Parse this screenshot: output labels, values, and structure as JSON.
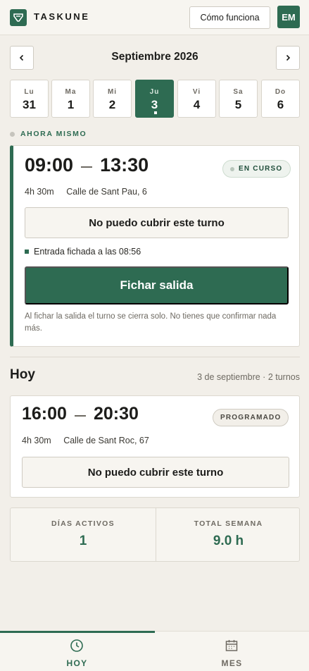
{
  "header": {
    "brand": "TASKUNE",
    "how_it_works": "Cómo funciona",
    "avatar_initials": "EM"
  },
  "calendar": {
    "month_title": "Septiembre 2026",
    "days": [
      {
        "name": "Lu",
        "date": "31",
        "active": false
      },
      {
        "name": "Ma",
        "date": "1",
        "active": false
      },
      {
        "name": "Mi",
        "date": "2",
        "active": false
      },
      {
        "name": "Ju",
        "date": "3",
        "active": true
      },
      {
        "name": "Vi",
        "date": "4",
        "active": false
      },
      {
        "name": "Sa",
        "date": "5",
        "active": false
      },
      {
        "name": "Do",
        "date": "6",
        "active": false
      }
    ]
  },
  "now": {
    "label": "AHORA MISMO",
    "shift": {
      "start": "09:00",
      "end": "13:30",
      "status": "EN CURSO",
      "duration": "4h 30m",
      "location": "Calle de Sant Pau, 6",
      "cant_cover": "No puedo cubrir este turno",
      "checkin": "Entrada fichada a las 08:56",
      "checkout_button": "Fichar salida",
      "note": "Al fichar la salida el turno se cierra solo. No tienes que confirmar nada más."
    }
  },
  "today": {
    "title": "Hoy",
    "meta": "3 de septiembre · 2 turnos",
    "shift": {
      "start": "16:00",
      "end": "20:30",
      "status": "PROGRAMADO",
      "duration": "4h 30m",
      "location": "Calle de Sant Roc, 67",
      "cant_cover": "No puedo cubrir este turno"
    }
  },
  "stats": {
    "active_days_label": "DÍAS ACTIVOS",
    "active_days_value": "1",
    "week_total_label": "TOTAL SEMANA",
    "week_total_value": "9.0 h"
  },
  "tabs": {
    "today": "HOY",
    "month": "MES"
  },
  "colors": {
    "accent": "#2e6b52",
    "background": "#f2efe9"
  }
}
